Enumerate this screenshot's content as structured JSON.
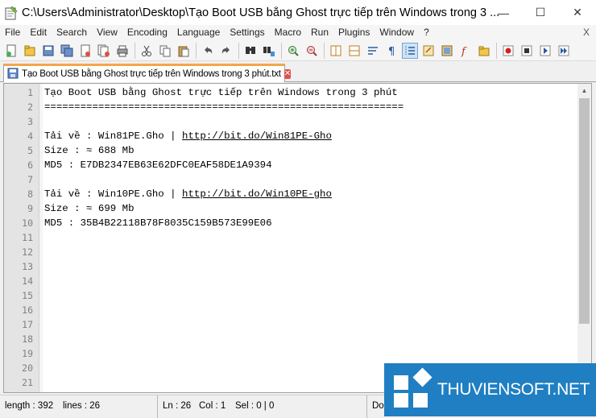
{
  "window": {
    "title": "C:\\Users\\Administrator\\Desktop\\Tạo Boot USB bằng Ghost trực tiếp trên Windows trong 3 ...",
    "minimize": "—",
    "maximize": "☐",
    "close": "✕"
  },
  "menu": {
    "items": [
      "File",
      "Edit",
      "Search",
      "View",
      "Encoding",
      "Language",
      "Settings",
      "Macro",
      "Run",
      "Plugins",
      "Window",
      "?"
    ],
    "close_label": "X"
  },
  "toolbar": {
    "icons": [
      "new-file-icon",
      "open-file-icon",
      "save-icon",
      "save-all-icon",
      "close-icon",
      "close-all-icon",
      "print-icon",
      "cut-icon",
      "copy-icon",
      "paste-icon",
      "undo-icon",
      "redo-icon",
      "find-icon",
      "replace-icon",
      "zoom-in-icon",
      "zoom-out-icon",
      "sync-vertical-icon",
      "sync-horizontal-icon",
      "word-wrap-icon",
      "show-all-chars-icon",
      "indent-guide-icon",
      "udl-icon",
      "doc-map-icon",
      "function-list-icon",
      "folder-workspace-icon",
      "record-macro-icon",
      "stop-record-icon",
      "play-macro-icon",
      "run-macro-multiple-icon"
    ]
  },
  "tab": {
    "label": "Tạo Boot USB bằng Ghost trực tiếp trên Windows trong 3 phút.txt"
  },
  "editor": {
    "line_numbers": [
      "1",
      "2",
      "3",
      "4",
      "5",
      "6",
      "7",
      "8",
      "9",
      "10",
      "11",
      "12",
      "13",
      "14",
      "15",
      "16",
      "17",
      "18",
      "19",
      "20",
      "21"
    ],
    "lines": [
      {
        "text": "Tạo Boot USB bằng Ghost trực tiếp trên Windows trong 3 phút"
      },
      {
        "text": "============================================================"
      },
      {
        "text": ""
      },
      {
        "text": "Tải về : Win81PE.Gho | ",
        "link": "http://bit.do/Win81PE-Gho"
      },
      {
        "text": "Size : ≈ 688 Mb"
      },
      {
        "text": "MD5 : E7DB2347EB63E62DFC0EAF58DE1A9394"
      },
      {
        "text": ""
      },
      {
        "text": "Tải về : Win10PE.Gho | ",
        "link": "http://bit.do/Win10PE-gho"
      },
      {
        "text": "Size : ≈ 699 Mb"
      },
      {
        "text": "MD5 : 35B4B22118B78F8035C159B573E99E06"
      }
    ]
  },
  "statusbar": {
    "length": "length : 392",
    "lines": "lines : 26",
    "ln": "Ln : 26",
    "col": "Col : 1",
    "sel": "Sel : 0 | 0",
    "eol": "Do"
  },
  "watermark": {
    "text": "THUVIENSOFT.NET"
  },
  "colors": {
    "tab_accent": "#f2a64a",
    "watermark_bg": "#1f7fc2"
  }
}
